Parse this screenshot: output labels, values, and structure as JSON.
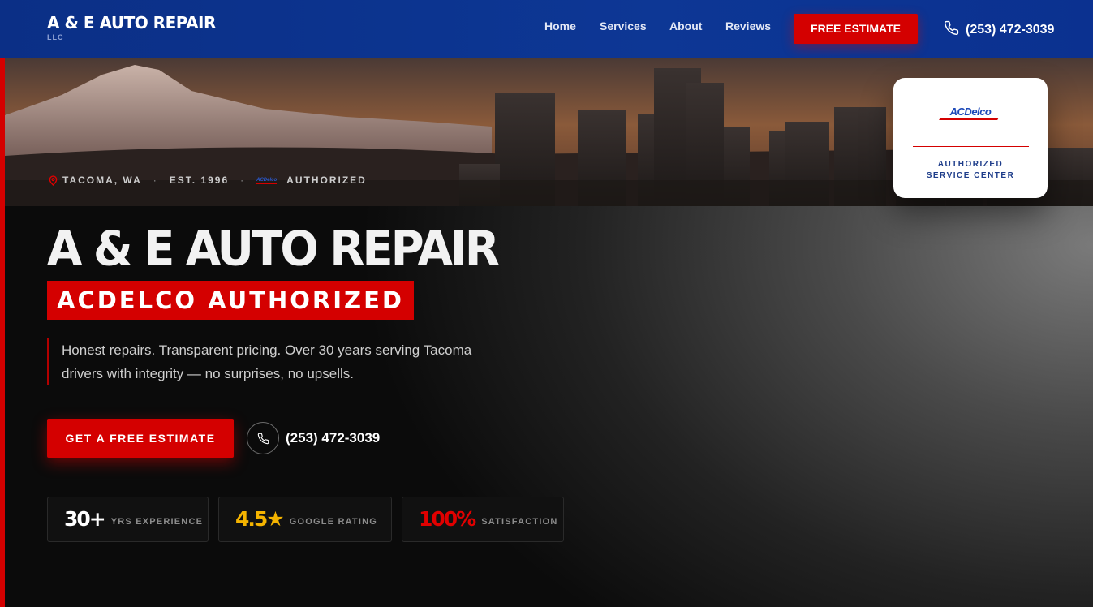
{
  "header": {
    "brand_name": "A & E AUTO REPAIR",
    "brand_sub": "LLC",
    "nav": [
      "Home",
      "Services",
      "About",
      "Reviews"
    ],
    "cta_label": "FREE ESTIMATE",
    "phone": "(253) 472-3039"
  },
  "hero": {
    "tagline": {
      "location": "TACOMA, WA",
      "established": "EST. 1996",
      "separator": "·",
      "brand_mark": "ACDelco",
      "authorized": "AUTHORIZED"
    },
    "badge": {
      "logo": "ACDelco",
      "line1": "AUTHORIZED",
      "line2": "SERVICE CENTER"
    },
    "title": "A & E AUTO REPAIR",
    "subtitle": "ACDELCO AUTHORIZED",
    "description": "Honest repairs. Transparent pricing. Over 30 years serving Tacoma drivers with integrity — no surprises, no upsells.",
    "cta_label": "GET A FREE ESTIMATE",
    "phone": "(253) 472-3039",
    "stats": [
      {
        "value": "30+",
        "label": "YRS EXPERIENCE",
        "color": "#ffffff"
      },
      {
        "value": "4.5★",
        "label": "GOOGLE RATING",
        "color": "#f5b400"
      },
      {
        "value": "100%",
        "label": "SATISFACTION",
        "color": "#e00000"
      }
    ]
  },
  "colors": {
    "header_blue": "#0d3795",
    "accent_red": "#d40000",
    "star_gold": "#f5b400"
  },
  "icons": [
    "phone-icon",
    "location-pin-icon"
  ]
}
